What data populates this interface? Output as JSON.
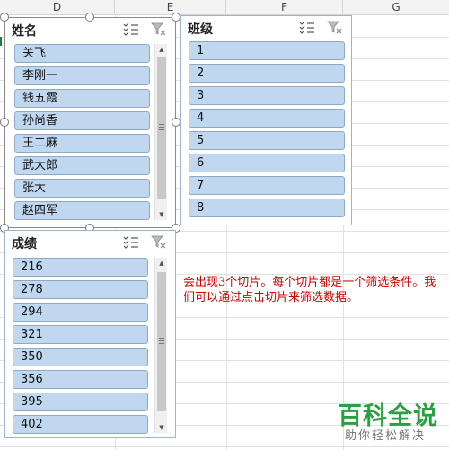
{
  "columns": [
    "D",
    "E",
    "F",
    "G"
  ],
  "slicers": [
    {
      "title": "姓名",
      "items": [
        "关飞",
        "李刚一",
        "钱五霞",
        "孙尚香",
        "王二麻",
        "武大郎",
        "张大",
        "赵四军"
      ]
    },
    {
      "title": "班级",
      "items": [
        "1",
        "2",
        "3",
        "4",
        "5",
        "6",
        "7",
        "8"
      ]
    },
    {
      "title": "成绩",
      "items": [
        "216",
        "278",
        "294",
        "321",
        "350",
        "356",
        "395",
        "402"
      ]
    }
  ],
  "annotation": "会出现3个切片。每个切片都是一个筛选条件。我们可以通过点击切片来筛选数据。",
  "watermark": {
    "title": "百科全说",
    "subtitle": "助你轻松解决"
  },
  "colors": {
    "slicer_item": "#bfd7ef",
    "annotation": "#d20000",
    "watermark": "#2aa140"
  },
  "icons": [
    "multi-select-icon",
    "clear-filter-icon",
    "scroll-up-icon",
    "scroll-down-icon"
  ]
}
